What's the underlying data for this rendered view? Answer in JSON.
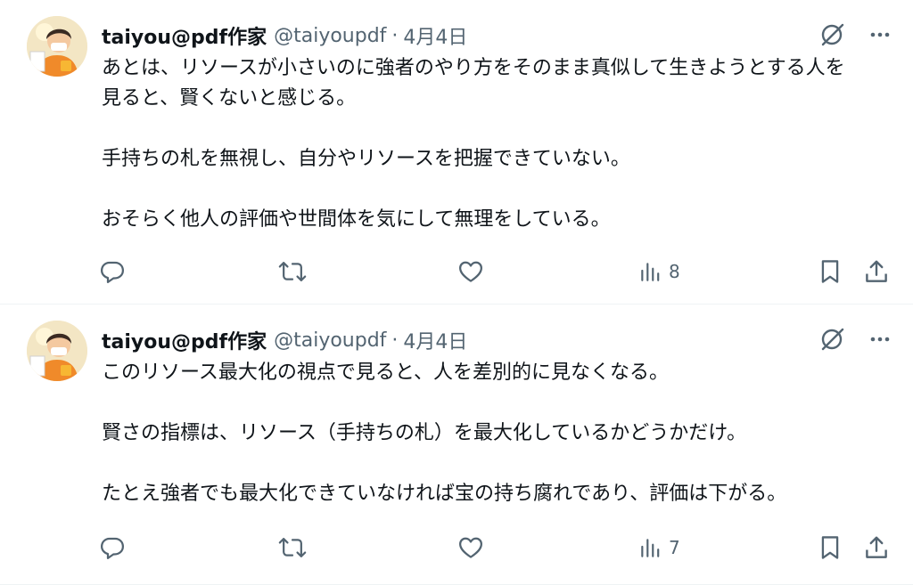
{
  "tweets": [
    {
      "name": "taiyou@pdf作家",
      "handle": "@taiyoupdf",
      "separator": "·",
      "date": "4月4日",
      "paragraphs": [
        "あとは、リソースが小さいのに強者のやり方をそのまま真似して生きようとする人を",
        "見ると、賢くないと感じる。",
        "手持ちの札を無視し、自分やリソースを把握できていない。",
        "おそらく他人の評価や世間体を気にして無理をしている。"
      ],
      "views": "8"
    },
    {
      "name": "taiyou@pdf作家",
      "handle": "@taiyoupdf",
      "separator": "·",
      "date": "4月4日",
      "paragraphs": [
        "このリソース最大化の視点で見ると、人を差別的に見なくなる。",
        "賢さの指標は、リソース（手持ちの札）を最大化しているかどうかだけ。",
        "たとえ強者でも最大化できていなければ宝の持ち腐れであり、評価は下がる。"
      ],
      "views": "7"
    }
  ],
  "icons": {
    "reply": "reply-icon",
    "retweet": "retweet-icon",
    "like": "like-icon",
    "views": "views-icon",
    "bookmark": "bookmark-icon",
    "share": "share-icon",
    "grok": "grok-icon",
    "more": "more-icon"
  },
  "colors": {
    "text": "#0f1419",
    "secondary": "#536471",
    "divider": "#eff3f4"
  }
}
